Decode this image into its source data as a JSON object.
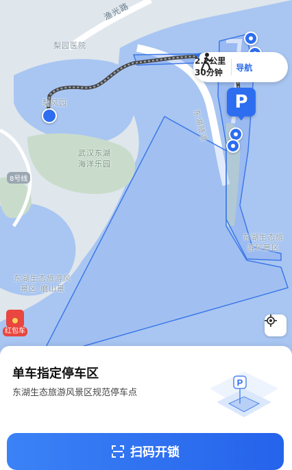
{
  "map": {
    "road_label": "渔光路",
    "labels": {
      "hospital": "梨园医院",
      "garden": "梨风园",
      "ocean_park": [
        "武汉东湖",
        "海洋乐园"
      ],
      "tunnel": "东湖隧道",
      "scenic_area_right": [
        "东湖生态旅",
        "游风景区"
      ],
      "scenic_area_left": [
        "东湖生态旅游风",
        "景区-磨山景"
      ]
    },
    "line_badge": "8号线",
    "icons": {
      "walk": "walking-person-icon",
      "navigate": "navigation-arrow-icon",
      "parking": "parking-p-icon",
      "locate": "locate-crosshair-icon",
      "red_packet": "red-envelope-icon",
      "scan": "scan-frame-icon"
    }
  },
  "route": {
    "distance": "2.2公里",
    "duration": "30分钟",
    "nav_label": "导航"
  },
  "parking": {
    "marker_label": "P"
  },
  "red_packet": {
    "label": "红包车"
  },
  "sheet": {
    "title": "单车指定停车区",
    "subtitle": "东湖生态旅游风景区规范停车点",
    "illustration_label": "P"
  },
  "scan_button": {
    "label": "扫码开锁"
  },
  "colors": {
    "accent": "#2d6ef0",
    "water": "#a9c6f2",
    "land": "#dfe6ec",
    "green": "#c9dccb",
    "red_packet": "#e8463f"
  }
}
